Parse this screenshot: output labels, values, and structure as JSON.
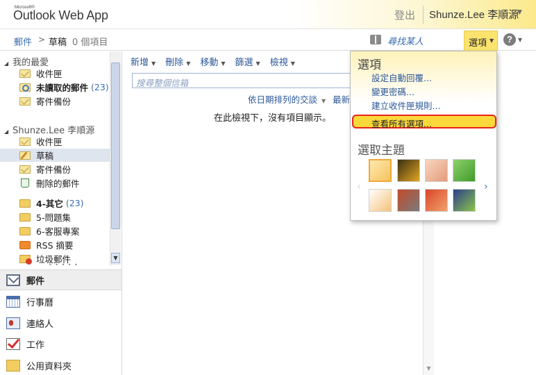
{
  "app": {
    "brand_small": "Microsoft®",
    "title": "Outlook Web App",
    "signout": "登出",
    "user": "Shunze.Lee 李順源"
  },
  "breadcrumb": {
    "root": "郵件",
    "arrow": ">",
    "current": "草稿",
    "count": "0 個項目"
  },
  "topbar": {
    "find_people": "尋找某人",
    "options": "選項",
    "help": "?"
  },
  "sidebar": {
    "favorites_title": "我的最愛",
    "favorites": [
      {
        "label": "收件匣",
        "count": ""
      },
      {
        "label": "未讀取的郵件",
        "count": "(23)"
      },
      {
        "label": "寄件備份",
        "count": ""
      }
    ],
    "mailbox_title": "Shunze.Lee 李順源",
    "folders": [
      {
        "label": "收件匣",
        "count": ""
      },
      {
        "label": "草稿",
        "count": ""
      },
      {
        "label": "寄件備份",
        "count": ""
      },
      {
        "label": "刪除的郵件",
        "count": ""
      },
      {
        "label": "4-其它",
        "count": "(23)"
      },
      {
        "label": "5-問題集",
        "count": ""
      },
      {
        "label": "6-客服專案",
        "count": ""
      },
      {
        "label": "RSS 摘要",
        "count": ""
      },
      {
        "label": "垃圾郵件",
        "count": ""
      }
    ],
    "splitter": "• • • • •"
  },
  "nav": {
    "items": [
      {
        "label": "郵件",
        "icon": "mail-icon"
      },
      {
        "label": "行事曆",
        "icon": "calendar-icon"
      },
      {
        "label": "連絡人",
        "icon": "contacts-icon"
      },
      {
        "label": "工作",
        "icon": "tasks-icon"
      },
      {
        "label": "公用資料夾",
        "icon": "public-folder-icon"
      }
    ]
  },
  "toolbar": {
    "new": "新增",
    "delete": "刪除",
    "move": "移動",
    "filter": "篩選",
    "view": "檢視"
  },
  "list": {
    "search_placeholder": "搜尋整個信箱",
    "sort_by": "依日期排列的交談",
    "sort_order": "最新的",
    "empty_message": "在此檢視下，沒有項目顯示。"
  },
  "options_menu": {
    "title": "選項",
    "links": [
      "設定自動回覆...",
      "變更密碼...",
      "建立收件匣規則..."
    ],
    "view_all": "查看所有選項...",
    "theme_title": "選取主題",
    "themes": [
      {
        "name": "Summer",
        "colors": [
          "#fde9b0",
          "#f6c25e"
        ]
      },
      {
        "name": "Bee",
        "colors": [
          "#3a2f10",
          "#e0a524"
        ]
      },
      {
        "name": "Peach",
        "colors": [
          "#f7d7c0",
          "#e59a7a"
        ]
      },
      {
        "name": "Leaf",
        "colors": [
          "#8fd16a",
          "#3f9b2b"
        ]
      },
      {
        "name": "Sunrise",
        "colors": [
          "#ffffff",
          "#f5c27a"
        ]
      },
      {
        "name": "Robot",
        "colors": [
          "#c24a2a",
          "#7b7b7b"
        ]
      },
      {
        "name": "Autumn",
        "colors": [
          "#d9452a",
          "#f2a26a"
        ]
      },
      {
        "name": "Creature",
        "colors": [
          "#2b3f8c",
          "#8bc34a"
        ]
      }
    ],
    "accent": "#fbd93b",
    "highlight_border": "#e8231c"
  }
}
